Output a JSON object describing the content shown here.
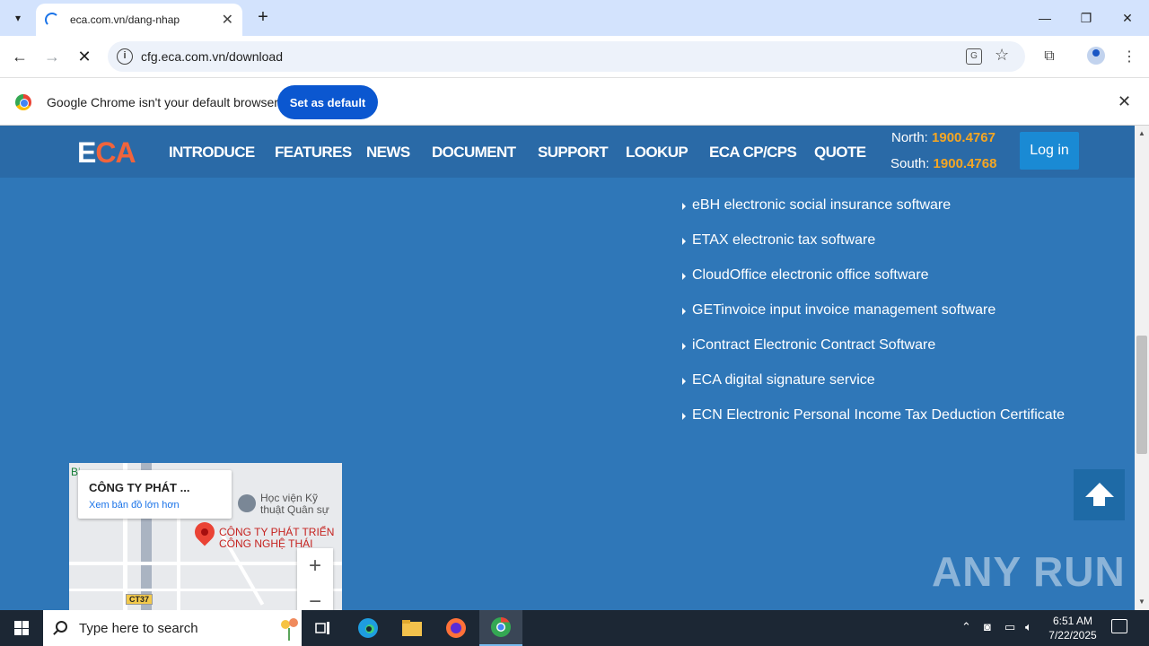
{
  "browser": {
    "tab_title": "eca.com.vn/dang-nhap",
    "url": "cfg.eca.com.vn/download",
    "infobar_message": "Google Chrome isn't your default browser",
    "set_default_label": "Set as default"
  },
  "site": {
    "logo_e": "E",
    "logo_ca": "CA",
    "menu": [
      "INTRODUCE",
      "FEATURES",
      "NEWS",
      "DOCUMENT",
      "SUPPORT",
      "LOOKUP",
      "ECA CP/CPS",
      "QUOTE"
    ],
    "hotline_north_label": "North:",
    "hotline_north": "1900.4767",
    "hotline_south_label": "South:",
    "hotline_south": "1900.4768",
    "login_label": "Log in",
    "products": [
      " eBH electronic social insurance software",
      "ETAX electronic tax software",
      "CloudOffice electronic office software",
      "GETinvoice input invoice management software",
      "iContract Electronic Contract Software",
      "ECA digital signature service",
      "ECN Electronic Personal Income Tax Deduction Certificate"
    ],
    "colors": {
      "header_bg": "#2a6aa7",
      "page_bg": "#2f77b8",
      "accent_orange": "#f0643c",
      "hotline": "#f5a623"
    }
  },
  "map": {
    "card_title": "CÔNG TY PHÁT ...",
    "card_link": "Xem bản đồ lớn hơn",
    "label_academy_1": "Học viện Kỹ",
    "label_academy_2": "thuật Quân sự",
    "label_company_1": "CÔNG TY PHÁT TRIỂN",
    "label_company_2": "CÔNG NGHỆ THÁI",
    "road_shield": "CT37",
    "edge_label": "Bi"
  },
  "watermark": "ANY RUN",
  "taskbar": {
    "search_placeholder": "Type here to search",
    "time": "6:51 AM",
    "date": "7/22/2025"
  }
}
